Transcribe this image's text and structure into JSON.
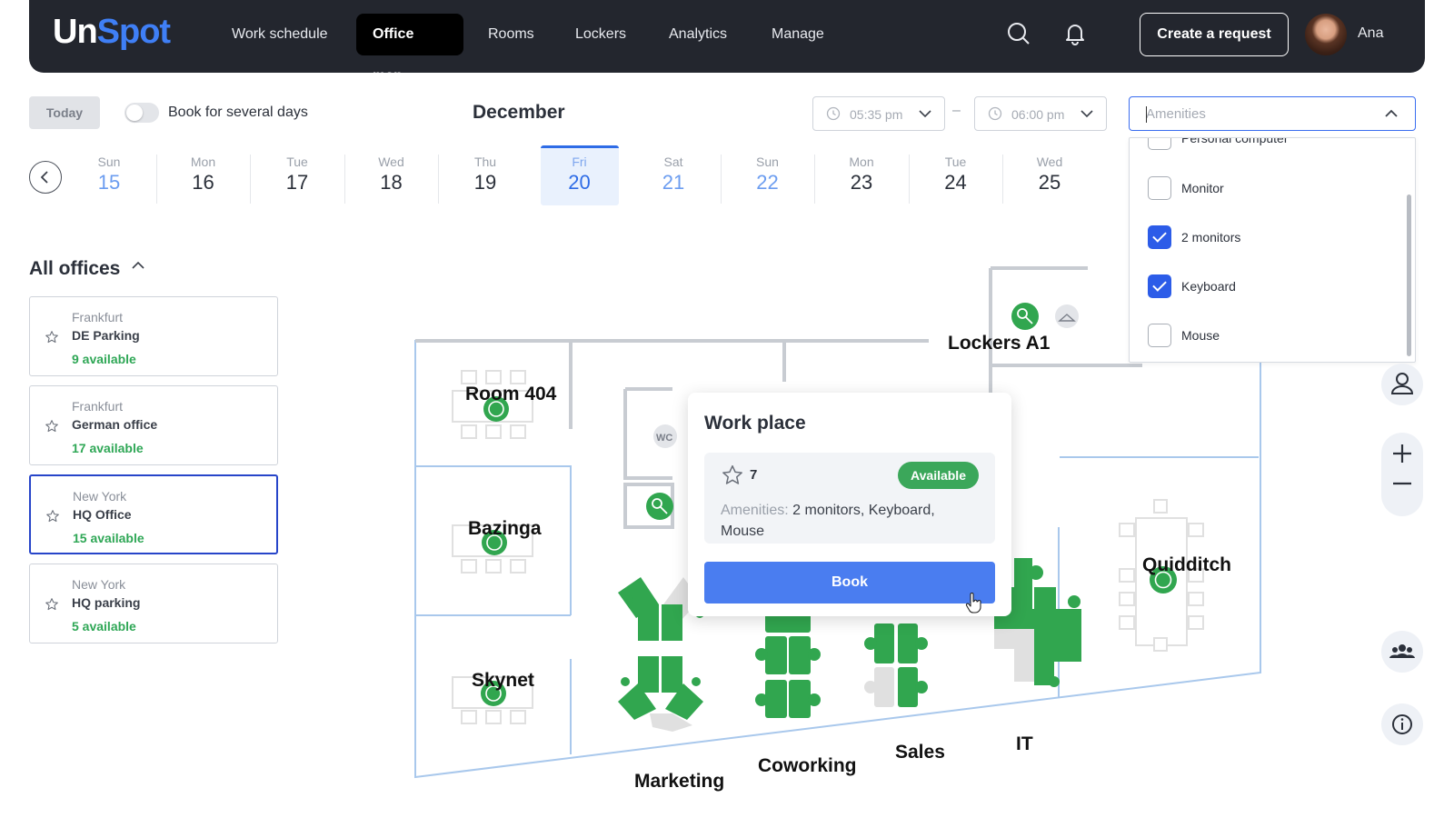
{
  "header": {
    "logo": {
      "part1": "Un",
      "part2": "Spot"
    },
    "nav": [
      "Work schedule",
      "Office map",
      "Rooms",
      "Lockers",
      "Analytics",
      "Manage"
    ],
    "active_nav": "Office map",
    "create_request_label": "Create a request",
    "user_name": "Ana",
    "icons": [
      "search-icon",
      "bell-icon"
    ]
  },
  "controls": {
    "today_label": "Today",
    "book_several_days_label": "Book for several days",
    "month": "December",
    "time_from": "05:35 pm",
    "time_to": "06:00 pm",
    "time_separator": "–",
    "amenities_placeholder": "Amenities"
  },
  "amenities": [
    {
      "label": "Personal computer",
      "checked": false
    },
    {
      "label": "Monitor",
      "checked": false
    },
    {
      "label": "2 monitors",
      "checked": true
    },
    {
      "label": "Keyboard",
      "checked": true
    },
    {
      "label": "Mouse",
      "checked": false
    }
  ],
  "dates": [
    {
      "name": "Sun",
      "day": "15"
    },
    {
      "name": "Mon",
      "day": "16"
    },
    {
      "name": "Tue",
      "day": "17"
    },
    {
      "name": "Wed",
      "day": "18"
    },
    {
      "name": "Thu",
      "day": "19"
    },
    {
      "name": "Fri",
      "day": "20",
      "selected": true
    },
    {
      "name": "Sat",
      "day": "21"
    },
    {
      "name": "Sun",
      "day": "22"
    },
    {
      "name": "Mon",
      "day": "23"
    },
    {
      "name": "Tue",
      "day": "24"
    },
    {
      "name": "Wed",
      "day": "25"
    }
  ],
  "offices": {
    "title": "All offices",
    "items": [
      {
        "city": "Frankfurt",
        "name": "DE Parking",
        "available": "9 available"
      },
      {
        "city": "Frankfurt",
        "name": "German office",
        "available": "17 available"
      },
      {
        "city": "New York",
        "name": "HQ Office",
        "available": "15 available",
        "selected": true
      },
      {
        "city": "New York",
        "name": "HQ parking",
        "available": "5 available"
      }
    ]
  },
  "map": {
    "rooms": [
      "Room 404",
      "Bazinga",
      "Skynet",
      "Lockers A1",
      "Quidditch",
      "Marketing",
      "Coworking",
      "Sales",
      "IT"
    ],
    "small_label": "WC",
    "colors": {
      "desk_green": "#31a64f",
      "desk_grey": "#e0e0e0",
      "wall": "#c8ccd2",
      "outer_wall": "#a9c8ec"
    }
  },
  "popup": {
    "title": "Work place",
    "place_number": "7",
    "status": "Available",
    "amenities_key": "Amenities:",
    "amenities_value": "2 monitors, Keyboard, Mouse",
    "book_label": "Book"
  },
  "tools": [
    "person-icon",
    "zoom-in-icon",
    "zoom-out-icon",
    "group-icon",
    "info-icon"
  ]
}
